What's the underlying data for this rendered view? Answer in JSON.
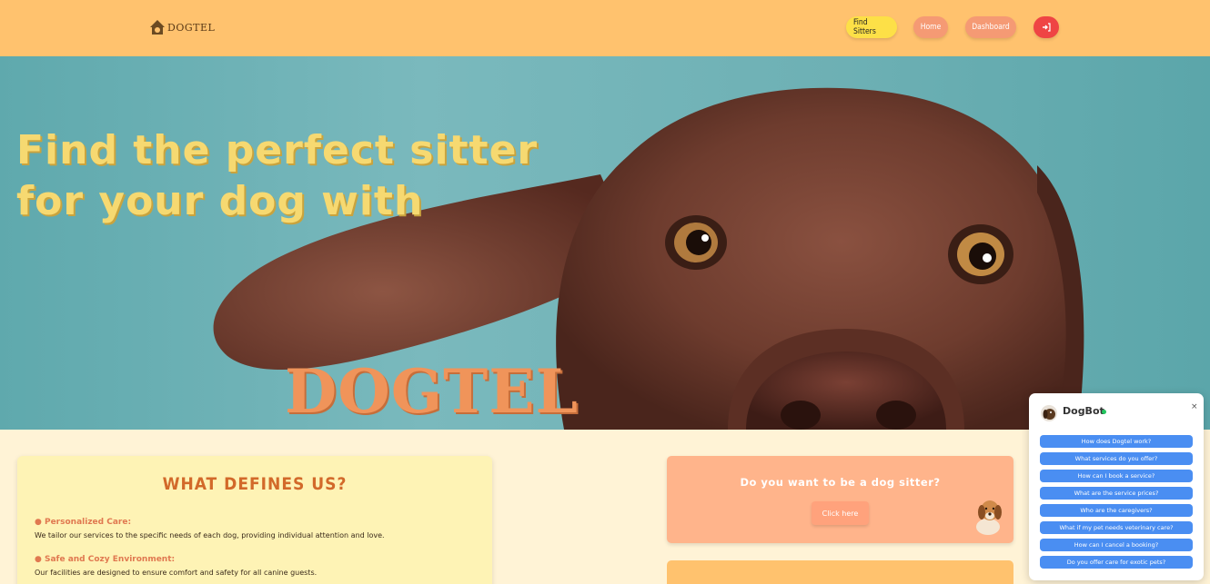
{
  "header": {
    "logo_text": "DOGTEL",
    "nav": {
      "find_sitters": "Find Sitters",
      "home": "Home",
      "dashboard": "Dashboard",
      "logout_icon": "logout-arrow"
    }
  },
  "hero": {
    "line1": "Find the perfect sitter",
    "line2": "for  your dog with",
    "brand": "DOGTEL"
  },
  "about": {
    "title": "WHAT DEFINES US?",
    "features": [
      {
        "title": "● Personalized Care:",
        "desc": "We tailor our services to the specific needs of each dog, providing individual attention and love."
      },
      {
        "title": "● Safe and Cozy Environment:",
        "desc": "Our facilities are designed to ensure comfort and safety for all canine guests."
      }
    ]
  },
  "sitter_card": {
    "question": "Do you want to be a dog sitter?",
    "button": "Click here"
  },
  "chatbot": {
    "name": "DogBot",
    "close": "×",
    "options": [
      "How does Dogtel work?",
      "What services do you offer?",
      "How can I book a service?",
      "What are the service prices?",
      "Who are the caregivers?",
      "What if my pet needs veterinary care?",
      "How can I cancel a booking?",
      "Do you offer care for exotic pets?"
    ]
  },
  "colors": {
    "header_bg": "#ffc26e",
    "page_bg": "#fff3d6",
    "accent_orange": "#f59a74",
    "find_yellow": "#fde047",
    "logout_red": "#ef4444",
    "chat_blue": "#4a8ef2"
  }
}
